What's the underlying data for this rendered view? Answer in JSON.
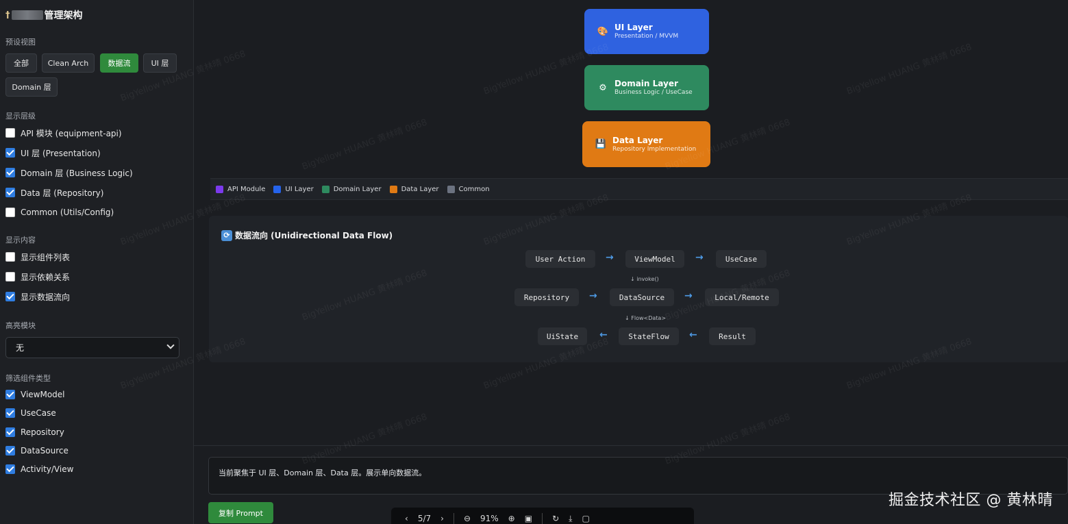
{
  "sidebar": {
    "title": "管理架构",
    "presets": {
      "label": "预设视图",
      "buttons": [
        "全部",
        "Clean Arch",
        "数据流",
        "UI 层",
        "Domain 层"
      ],
      "active_index": 2
    },
    "levels": {
      "label": "显示层级",
      "items": [
        {
          "label": "API 模块 (equipment-api)",
          "checked": false
        },
        {
          "label": "UI 层 (Presentation)",
          "checked": true
        },
        {
          "label": "Domain 层 (Business Logic)",
          "checked": true
        },
        {
          "label": "Data 层 (Repository)",
          "checked": true
        },
        {
          "label": "Common (Utils/Config)",
          "checked": false
        }
      ]
    },
    "content": {
      "label": "显示内容",
      "items": [
        {
          "label": "显示组件列表",
          "checked": false
        },
        {
          "label": "显示依赖关系",
          "checked": false
        },
        {
          "label": "显示数据流向",
          "checked": true
        }
      ]
    },
    "highlight": {
      "label": "高亮模块",
      "selected": "无"
    },
    "component_filter": {
      "label": "筛选组件类型",
      "items": [
        {
          "label": "ViewModel",
          "checked": true
        },
        {
          "label": "UseCase",
          "checked": true
        },
        {
          "label": "Repository",
          "checked": true
        },
        {
          "label": "DataSource",
          "checked": true
        },
        {
          "label": "Activity/View",
          "checked": true
        }
      ]
    }
  },
  "layers": [
    {
      "title": "UI Layer",
      "subtitle": "Presentation / MVVM",
      "color": "#2f62e0",
      "icon": "palette-icon"
    },
    {
      "title": "Domain Layer",
      "subtitle": "Business Logic / UseCase",
      "color": "#2e8a5f",
      "icon": "gear-icon"
    },
    {
      "title": "Data Layer",
      "subtitle": "Repository Implementation",
      "color": "#e07a14",
      "icon": "floppy-disk-icon"
    }
  ],
  "legend": [
    {
      "label": "API Module",
      "color": "#7c3aed"
    },
    {
      "label": "UI Layer",
      "color": "#2563eb"
    },
    {
      "label": "Domain Layer",
      "color": "#2e8a5f"
    },
    {
      "label": "Data Layer",
      "color": "#e07a14"
    },
    {
      "label": "Common",
      "color": "#6b7280"
    }
  ],
  "data_flow": {
    "title": "数据流向 (Unidirectional Data Flow)",
    "row1": [
      "User Action",
      "ViewModel",
      "UseCase"
    ],
    "note1": "↓ invoke()",
    "row2": [
      "Repository",
      "DataSource",
      "Local/Remote"
    ],
    "note2": "↓ Flow<Data>",
    "row3": [
      "UiState",
      "StateFlow",
      "Result"
    ],
    "arrow_right": "→",
    "arrow_left": "←"
  },
  "prompt": {
    "text": "当前聚焦于 UI 层、Domain 层、Data 层。展示单向数据流。",
    "copy_label": "复制 Prompt"
  },
  "viewer": {
    "page": "5/7",
    "zoom": "91%"
  },
  "watermark": {
    "corner": "掘金技术社区 @ 黄林晴",
    "tile": "BigYellow HUANG 黄林晴 0668"
  }
}
